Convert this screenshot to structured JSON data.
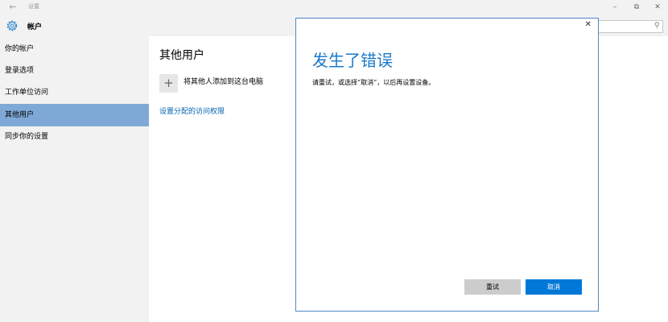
{
  "titlebar": {
    "title": "设置",
    "back_icon": "arrow-left-icon",
    "min_icon": "minimize-icon",
    "max_icon": "maximize-icon",
    "close_icon": "close-icon"
  },
  "header": {
    "title": "帐户",
    "gear_icon": "gear-icon",
    "search_value": "",
    "search_icon": "search-icon"
  },
  "sidebar": {
    "items": [
      {
        "label": "你的帐户"
      },
      {
        "label": "登录选项"
      },
      {
        "label": "工作单位访问"
      },
      {
        "label": "其他用户",
        "active": true
      },
      {
        "label": "同步你的设置"
      }
    ]
  },
  "main": {
    "title": "其他用户",
    "add_label": "将其他人添加到这台电脑",
    "assigned_link": "设置分配的访问权限"
  },
  "dialog": {
    "title": "发生了错误",
    "message": "请重试，或选择“取消”，以后再设置设备。",
    "retry_label": "重试",
    "cancel_label": "取消"
  },
  "colors": {
    "accent": "#0078d7",
    "title_blue": "#1979ca",
    "sidebar_active": "#7ea9d6",
    "link": "#0063b1"
  }
}
